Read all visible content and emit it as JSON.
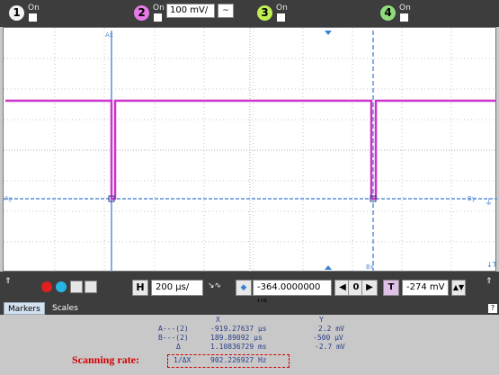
{
  "channels": [
    {
      "num": "1",
      "state": "On",
      "color": "#f2f2f2"
    },
    {
      "num": "2",
      "state": "On",
      "color": "#e87ae8"
    },
    {
      "num": "3",
      "state": "On",
      "color": "#c0ee50"
    },
    {
      "num": "4",
      "state": "On",
      "color": "#90dc7c"
    }
  ],
  "ch2": {
    "scale": "100 mV/",
    "coupling": "~"
  },
  "cursors": {
    "a": "Ax",
    "b": "Bx",
    "ay": "Ay",
    "by": "By"
  },
  "controls": {
    "h_label": "H",
    "timebase": "200 µs/",
    "position": "-364.0000000 µs",
    "nav": "0",
    "trig_label": "T",
    "trig_level": "-274 mV"
  },
  "tabs": [
    "Markers",
    "Scales"
  ],
  "measurements": {
    "x_header": "X",
    "y_header": "Y",
    "a_label": "A---(2)",
    "a_x": "-919.27637 µs",
    "a_y": "2.2 mV",
    "b_label": "B---(2)",
    "b_x": "189.89092 µs",
    "b_y": "-500 µV",
    "d_label": "Δ",
    "d_x": "1.10836729 ms",
    "d_y": "-2.7 mV",
    "inv_label": "1/ΔX",
    "inv_x": "902.226927 Hz"
  },
  "annotation": {
    "label": "Scanning rate:"
  },
  "colors": {
    "trace": "#cc33cc",
    "cursor": "#5b8fd6",
    "ground": "#5b8fd6",
    "annot": "#d00000",
    "measure": "#2a3f8a"
  }
}
